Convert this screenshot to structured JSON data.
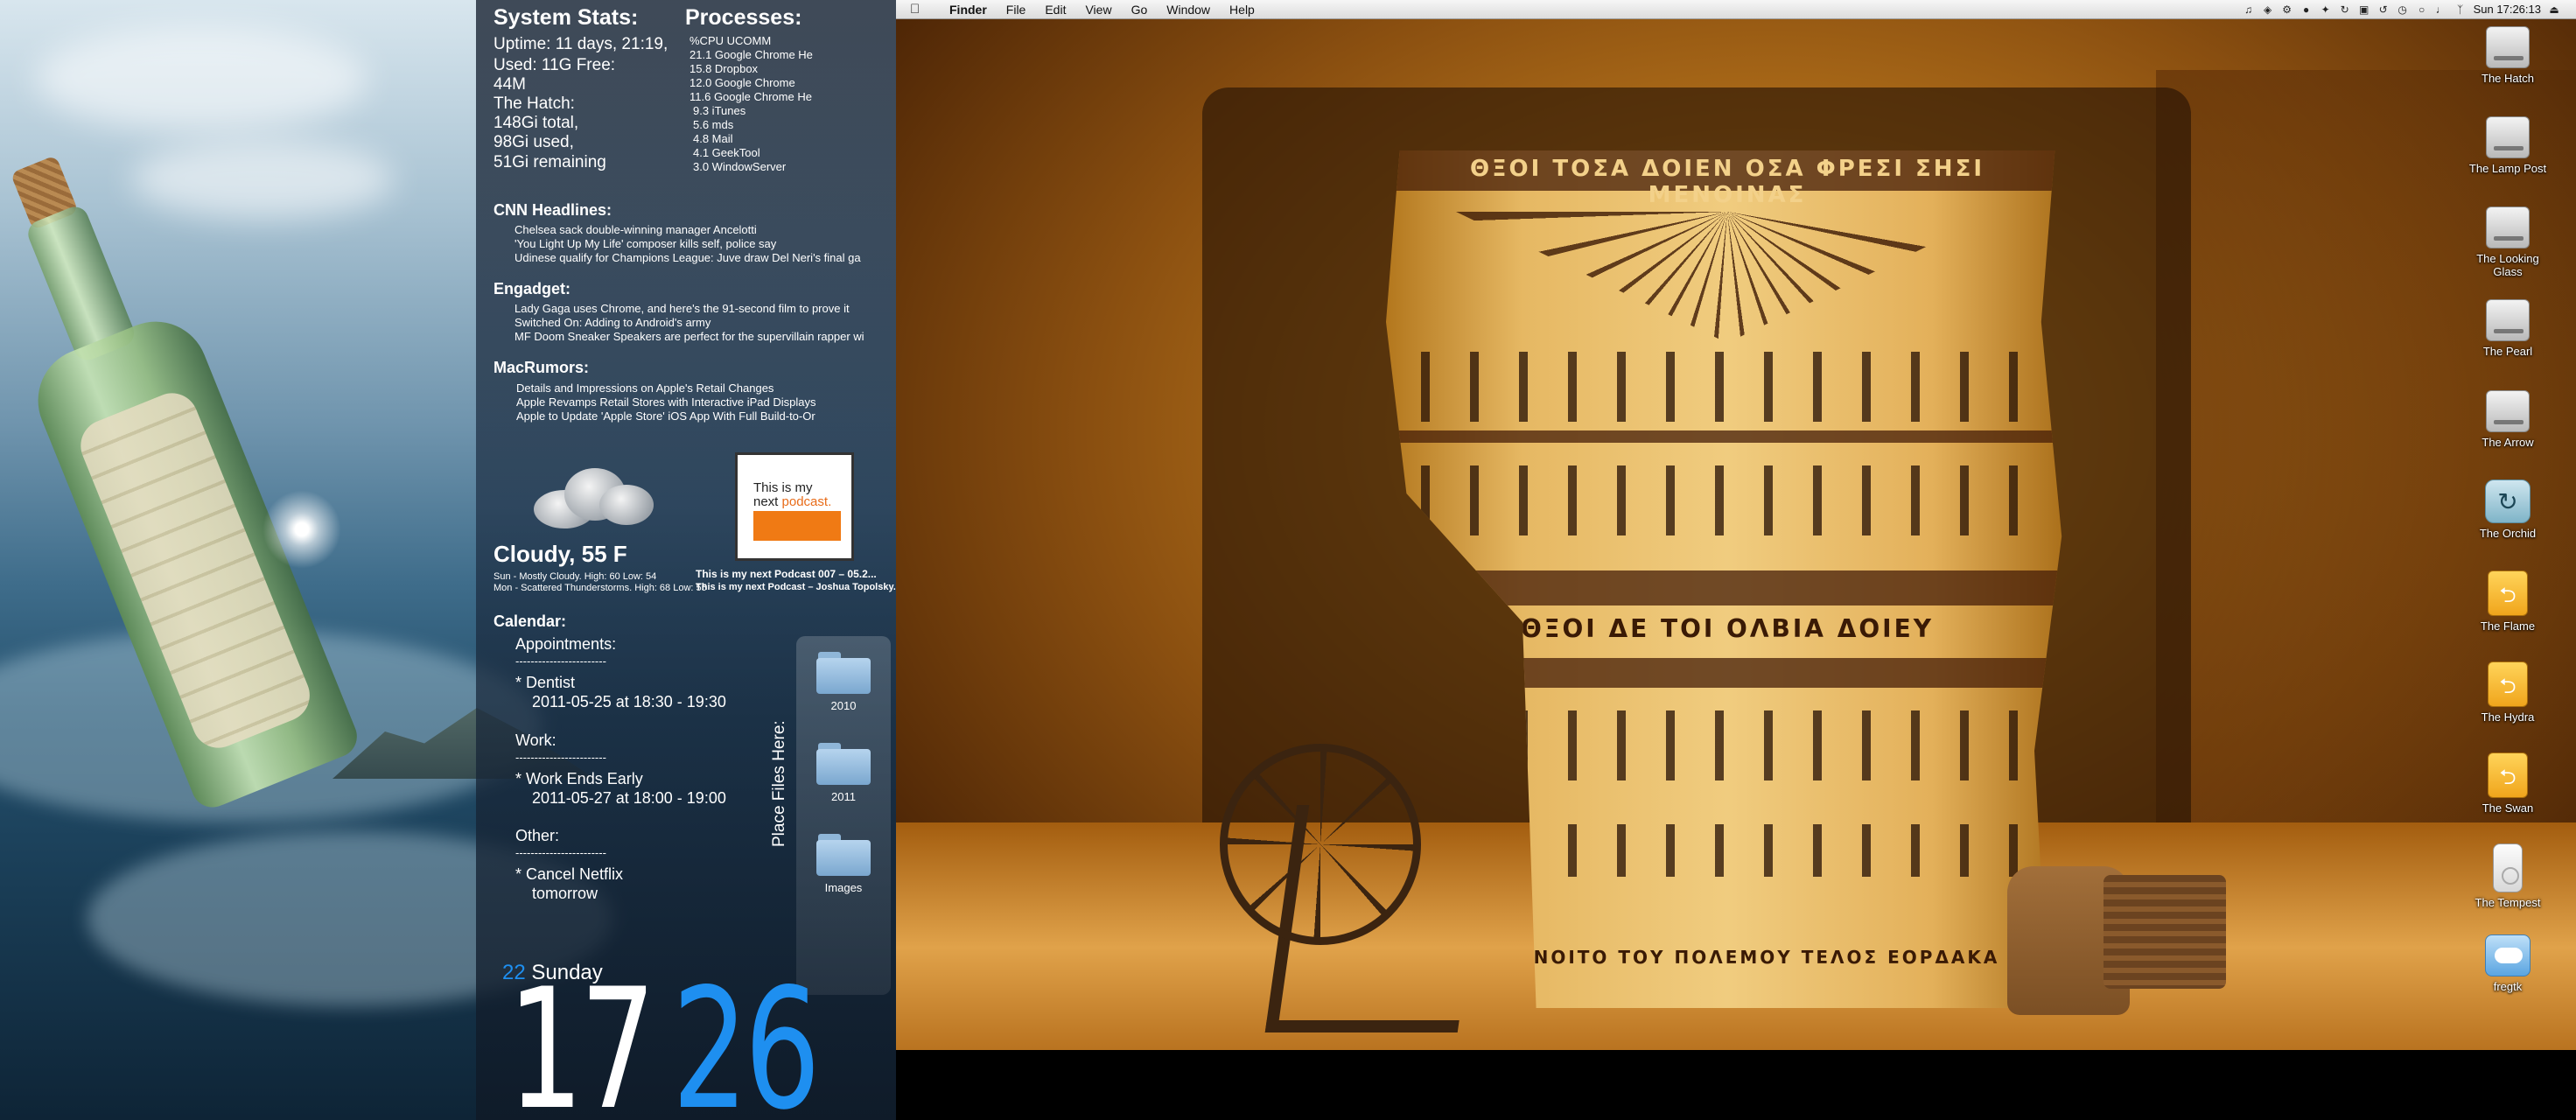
{
  "system_stats": {
    "title": "System Stats:",
    "lines": [
      "Uptime: 11 days, 21:19,",
      "Used: 11G Free:",
      "44M",
      "The Hatch:",
      "148Gi total,",
      "98Gi used,",
      "51Gi remaining"
    ]
  },
  "processes": {
    "title": "Processes:",
    "lines": [
      "%CPU UCOMM",
      "21.1 Google Chrome He",
      "15.8 Dropbox",
      "12.0 Google Chrome",
      "11.6 Google Chrome He",
      "9.3 iTunes",
      "5.6 mds",
      "4.8 Mail",
      "4.1 GeekTool",
      "3.0 WindowServer"
    ]
  },
  "cnn": {
    "title": "CNN Headlines:",
    "items": [
      "Chelsea sack double-winning manager Ancelotti",
      "'You Light Up My Life' composer kills self, police say",
      "Udinese qualify for Champions League: Juve draw Del Neri's final ga"
    ]
  },
  "engadget": {
    "title": "Engadget:",
    "items": [
      "Lady Gaga uses Chrome, and here's the 91-second film to prove it",
      "Switched On: Adding to Android's army",
      "MF Doom Sneaker Speakers are perfect for the supervillain rapper wi"
    ]
  },
  "macrumors": {
    "title": "MacRumors:",
    "items": [
      "Details and Impressions on Apple's Retail Changes",
      "Apple Revamps Retail Stores with Interactive iPad Displays",
      "Apple to Update 'Apple Store' iOS App With Full Build-to-Or"
    ]
  },
  "weather": {
    "condition": "Cloudy, 55 F",
    "forecast": [
      "Sun - Mostly Cloudy. High: 60 Low: 54",
      "Mon - Scattered Thunderstorms. High: 68 Low: 55"
    ],
    "icon": "cloud-icon"
  },
  "podcast": {
    "art_line1": "This is my",
    "art_line2a": "next ",
    "art_line2b": "podcast.",
    "title": "This is my next Podcast 007 – 05.2...",
    "subtitle": "This is my next Podcast – Joshua Topolsky..."
  },
  "calendar": {
    "title": "Calendar:",
    "appointments_label": "Appointments:",
    "divider": "------------------------",
    "dentist": "* Dentist",
    "dentist_time": "2011-05-25 at 18:30 - 19:30",
    "work_label": "Work:",
    "work_item": "* Work Ends Early",
    "work_time": "2011-05-27 at 18:00 - 19:00",
    "other_label": "Other:",
    "other_item": "* Cancel Netflix",
    "other_item2": "tomorrow"
  },
  "shelf": {
    "label": "Place Files Here:",
    "folders": [
      "2010",
      "2011",
      "Images"
    ]
  },
  "clock": {
    "day_number": "22",
    "day_name": "Sunday",
    "hour": "17",
    "minute": "26"
  },
  "menubar": {
    "app_name": "Finder",
    "menus": [
      "File",
      "Edit",
      "View",
      "Go",
      "Window",
      "Help"
    ],
    "clock": "Sun 17:26:13",
    "status_icons": [
      "music-note-icon",
      "dropbox-icon",
      "gear-icon",
      "growl-icon",
      "twitter-icon",
      "sync-icon",
      "display-icon",
      "timemachine-icon",
      "clock-icon",
      "chat-icon",
      "volume-icon",
      "bluetooth-icon",
      "eject-icon"
    ]
  },
  "desktop_icons": [
    {
      "label": "The Hatch",
      "type": "hdd"
    },
    {
      "label": "The Lamp Post",
      "type": "hdd"
    },
    {
      "label": "The Looking Glass",
      "type": "hdd"
    },
    {
      "label": "The Pearl",
      "type": "hdd"
    },
    {
      "label": "The Arrow",
      "type": "hdd"
    },
    {
      "label": "The Orchid",
      "type": "timemachine"
    },
    {
      "label": "The Flame",
      "type": "usb"
    },
    {
      "label": "The Hydra",
      "type": "usb"
    },
    {
      "label": "The Swan",
      "type": "usb"
    },
    {
      "label": "The Tempest",
      "type": "ipod"
    },
    {
      "label": "fregtk",
      "type": "idisk"
    }
  ],
  "wallpaper_text": {
    "top": "ΘΞΟΙ ΤΟΣΑ ΔΟΙΕΝ ΟΣΑ ΦΡΕΣΙ ΣΗΣΙ ΜΕΝΟΙΝΑΣ",
    "middle": "ΘΞΟΙ ΔΕ ΤΟΙ ΟΛΒΙΑ ΔΟΙΕΥ",
    "bottom": "...ΑΠΟΝΟΙΤΟ ΤΟΥ ΠΟΛΕΜΟΥ ΤΕΛΟΣ ΕΟΡΔΑΚΑ"
  },
  "colors": {
    "clock_minute": "#1e8ff0",
    "podcast_orange": "#f07a14"
  }
}
